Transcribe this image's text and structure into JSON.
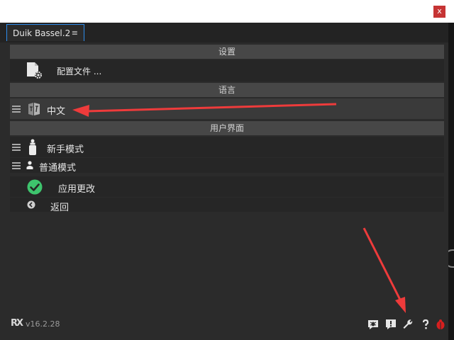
{
  "window": {
    "close_label": "x"
  },
  "tab": {
    "title": "Duik Bassel.2",
    "menu_glyph": "≡"
  },
  "sections": {
    "settings": {
      "header": "设置",
      "config_label": "配置文件 ..."
    },
    "language": {
      "header": "语言",
      "current": "中文"
    },
    "ui": {
      "header": "用户界面",
      "beginner": "新手模式",
      "normal": "普通模式"
    }
  },
  "actions": {
    "apply": "应用更改",
    "back": "返回"
  },
  "footer": {
    "logo": "RX",
    "version": "v16.2.28"
  },
  "colors": {
    "accent": "#2d8ceb",
    "apply_green": "#3ec46d",
    "arrow_red": "#ee3b3b",
    "bug_red": "#d61f1f"
  }
}
